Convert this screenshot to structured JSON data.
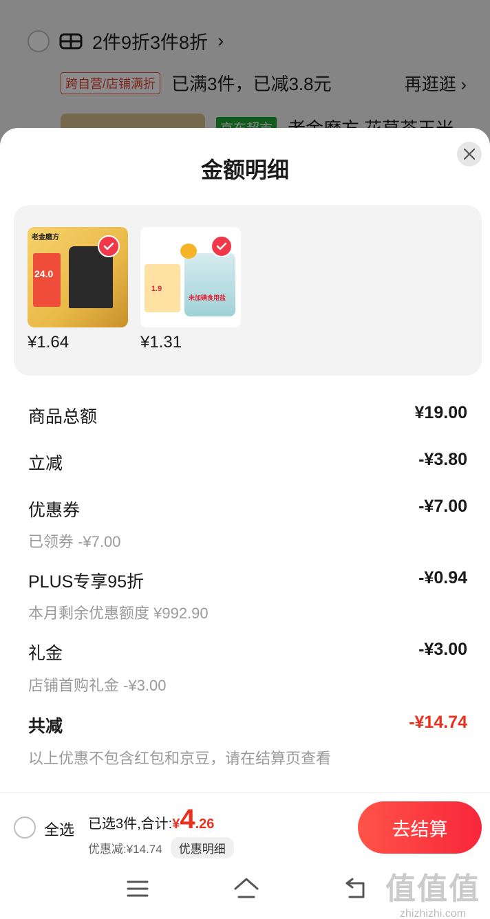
{
  "background_cart": {
    "promo_title": "2件9折3件8折",
    "promo_chevron": "›",
    "tag_label": "跨自营/店铺满折",
    "status_text": "已满3件，已减3.8元",
    "more_link": "再逛逛 ›",
    "store_tag": "京东超市",
    "product_partial_title": "老金磨方 花草茶玉米"
  },
  "sheet": {
    "title": "金额明细",
    "close_icon": "close-icon"
  },
  "products": [
    {
      "price": "¥1.64",
      "brand": "老金磨方",
      "badge": "24.0"
    },
    {
      "price": "¥1.31",
      "badge": "1.9",
      "label": "未加碘食用盐"
    }
  ],
  "details": {
    "total": {
      "label": "商品总额",
      "value": "¥19.00"
    },
    "instant": {
      "label": "立减",
      "value": "-¥3.80"
    },
    "coupon": {
      "label": "优惠券",
      "value": "-¥7.00",
      "sub": "已领券 -¥7.00"
    },
    "plus": {
      "label": "PLUS专享95折",
      "value": "-¥0.94",
      "sub": "本月剩余优惠额度 ¥992.90"
    },
    "gift": {
      "label": "礼金",
      "value": "-¥3.00",
      "sub": "店铺首购礼金 -¥3.00"
    },
    "sum": {
      "label": "共减",
      "value": "-¥14.74",
      "note": "以上优惠不包含红包和京豆，请在结算页查看"
    }
  },
  "bottom_bar": {
    "select_all": "全选",
    "selected_text": "已选3件,合计:",
    "currency": "¥",
    "amount_int": "4",
    "amount_dec": ".26",
    "discount_text": "优惠减:¥14.74",
    "detail_button": "优惠明细",
    "checkout_button": "去结算"
  },
  "watermark": {
    "chars": "值值值",
    "url": "zhizhizhi.com"
  },
  "colors": {
    "accent": "#e8321f",
    "checkout_gradient_start": "#ff5447",
    "checkout_gradient_end": "#f8263b"
  }
}
